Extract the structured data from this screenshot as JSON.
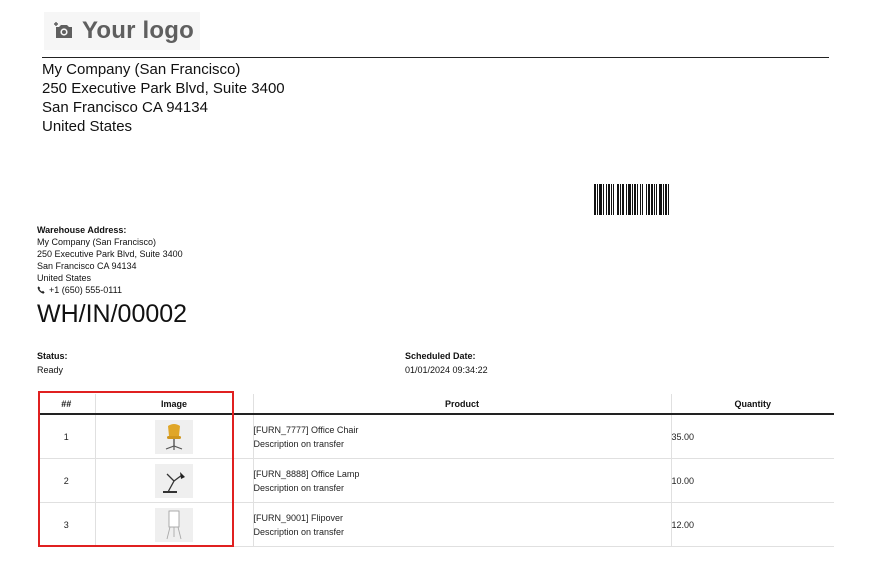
{
  "logo": {
    "text": "Your logo",
    "icon": "camera-plus-icon"
  },
  "company": {
    "name": "My Company (San Francisco)",
    "street": "250 Executive Park Blvd, Suite 3400",
    "city": "San Francisco CA 94134",
    "country": "United States"
  },
  "warehouse": {
    "heading": "Warehouse Address:",
    "name": "My Company (San Francisco)",
    "street": "250 Executive Park Blvd, Suite 3400",
    "city": "San Francisco CA 94134",
    "country": "United States",
    "phone": "+1 (650) 555-0111",
    "phone_icon": "phone-icon"
  },
  "document": {
    "title": "WH/IN/00002"
  },
  "status": {
    "label": "Status:",
    "value": "Ready"
  },
  "scheduled": {
    "label": "Scheduled Date:",
    "value": "01/01/2024 09:34:22"
  },
  "table": {
    "headers": [
      "##",
      "Image",
      "Product",
      "Quantity"
    ],
    "rows": [
      {
        "num": "1",
        "product": "[FURN_7777] Office Chair",
        "description": "Description on transfer",
        "quantity": "35.00",
        "image_icon": "office-chair-icon"
      },
      {
        "num": "2",
        "product": "[FURN_8888] Office Lamp",
        "description": "Description on transfer",
        "quantity": "10.00",
        "image_icon": "office-lamp-icon"
      },
      {
        "num": "3",
        "product": "[FURN_9001] Flipover",
        "description": "Description on transfer",
        "quantity": "12.00",
        "image_icon": "flipover-icon"
      }
    ]
  },
  "colors": {
    "highlight": "#e02020",
    "header_rule": "#222222"
  }
}
